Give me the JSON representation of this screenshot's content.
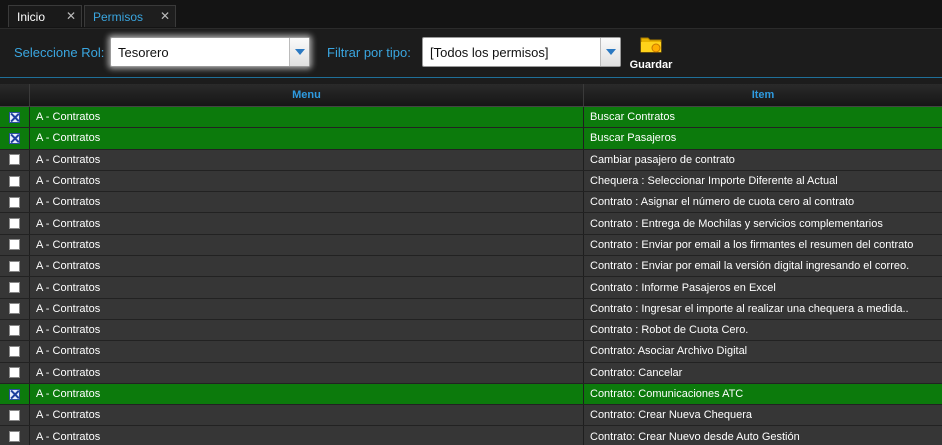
{
  "tabs": [
    {
      "label": "Inicio",
      "close": "✕"
    },
    {
      "label": "Permisos",
      "close": "✕"
    }
  ],
  "toolbar": {
    "rol_label": "Seleccione Rol:",
    "rol_value": "Tesorero",
    "tipo_label": "Filtrar por tipo:",
    "tipo_value": "[Todos los permisos]",
    "save_label": "Guardar",
    "save_icon": "folder-icon"
  },
  "grid": {
    "columns": [
      "Menu",
      "Item"
    ],
    "rows": [
      {
        "checked": true,
        "menu": "A - Contratos",
        "item": "Buscar Contratos"
      },
      {
        "checked": true,
        "menu": "A - Contratos",
        "item": "Buscar Pasajeros"
      },
      {
        "checked": false,
        "menu": "A - Contratos",
        "item": "Cambiar pasajero de contrato"
      },
      {
        "checked": false,
        "menu": "A - Contratos",
        "item": "Chequera : Seleccionar Importe Diferente al Actual"
      },
      {
        "checked": false,
        "menu": "A - Contratos",
        "item": "Contrato : Asignar el número de cuota cero al contrato"
      },
      {
        "checked": false,
        "menu": "A - Contratos",
        "item": "Contrato : Entrega de Mochilas y servicios complementarios"
      },
      {
        "checked": false,
        "menu": "A - Contratos",
        "item": "Contrato : Enviar por email a los firmantes el resumen del contrato"
      },
      {
        "checked": false,
        "menu": "A - Contratos",
        "item": "Contrato : Enviar por email la versión digital ingresando el correo."
      },
      {
        "checked": false,
        "menu": "A - Contratos",
        "item": "Contrato : Informe Pasajeros en Excel"
      },
      {
        "checked": false,
        "menu": "A - Contratos",
        "item": "Contrato : Ingresar el importe al realizar una chequera a medida.."
      },
      {
        "checked": false,
        "menu": "A - Contratos",
        "item": "Contrato : Robot de Cuota Cero."
      },
      {
        "checked": false,
        "menu": "A - Contratos",
        "item": "Contrato: Asociar Archivo Digital"
      },
      {
        "checked": false,
        "menu": "A - Contratos",
        "item": "Contrato: Cancelar"
      },
      {
        "checked": true,
        "menu": "A - Contratos",
        "item": "Contrato: Comunicaciones ATC"
      },
      {
        "checked": false,
        "menu": "A - Contratos",
        "item": "Contrato: Crear Nueva Chequera"
      },
      {
        "checked": false,
        "menu": "A - Contratos",
        "item": "Contrato: Crear Nuevo desde Auto Gestión"
      }
    ]
  },
  "colors": {
    "selected_row": "#0c7a0c",
    "row": "#363636",
    "accent": "#3aa6e0"
  }
}
